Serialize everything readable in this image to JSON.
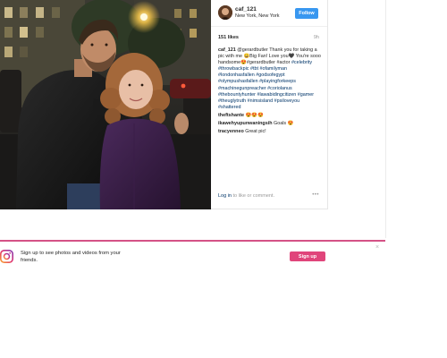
{
  "post": {
    "username": "caf_121",
    "location": "New York, New York",
    "follow_label": "Follow",
    "likes": "151 likes",
    "age": "9h",
    "caption": {
      "author": "caf_121",
      "text": "@gerardbutler Thank you for taking a pic with me 😀Big Fan! Love you🖤 You're sooo handsome😍#gerardbutler #actor ",
      "tags": "#celebrity #throwbackpic #tbt #ofamilyman #londonhasfallen #godsofegypt #olympushasfallen #playingforkeeps #machinegunpreacher #coriolanus #thebountyhunter #lawabidingcitizen #gamer #theuglytruth #nimsisland #psiloveyou #shattered"
    },
    "comments": [
      {
        "author": "theftshante",
        "text": " 😍😍😍"
      },
      {
        "author": "ikawehyupunwaningsih",
        "text": " Goals 😍"
      },
      {
        "author": "tracyenneo",
        "text": " Great pic!"
      }
    ],
    "login_link": "Log in",
    "login_suffix": " to like or comment.",
    "more": "•••"
  },
  "banner": {
    "text": "Sign up to see photos and videos from your friends.",
    "signup_label": "Sign up",
    "close": "×"
  },
  "colors": {
    "accent_blue": "#3897f0",
    "signup_pink": "#e0457b",
    "hashtag_blue": "#003569"
  }
}
